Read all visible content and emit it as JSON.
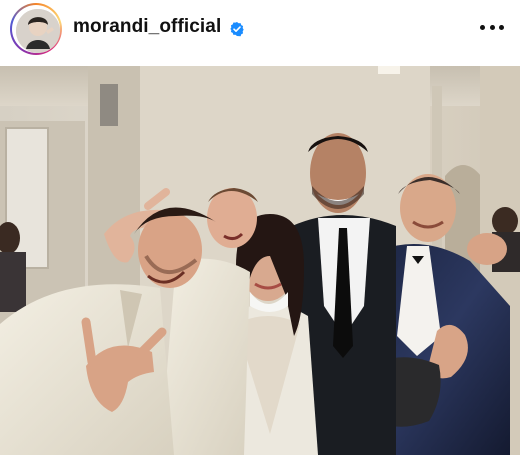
{
  "post": {
    "username": "morandi_official",
    "verified": true,
    "avatar_icon": "profile-avatar",
    "verified_icon": "verified-badge-icon",
    "more_icon": "more-options-icon"
  },
  "colors": {
    "text": "#111111",
    "verified_blue": "#1a8cff",
    "background": "#ffffff"
  }
}
